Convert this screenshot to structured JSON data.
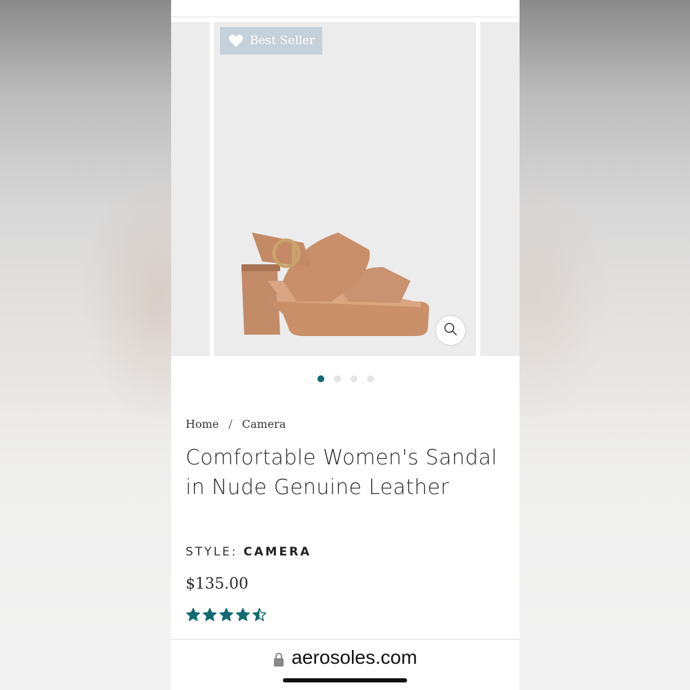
{
  "carousel": {
    "badge_label": "Best Seller",
    "slide_count": 4,
    "active_slide": 1
  },
  "breadcrumb": {
    "items": [
      "Home",
      "Camera"
    ],
    "separator": "/"
  },
  "product": {
    "title": "Comfortable Women's Sandal in Nude Genuine Leather",
    "style_label": "STYLE:",
    "style_value": "CAMERA",
    "price": "$135.00",
    "rating": 4.5,
    "rating_max": 5
  },
  "browser": {
    "url": "aerosoles.com"
  },
  "colors": {
    "accent": "#146a72",
    "badge_bg": "#c4d0da",
    "image_bg": "#ececec"
  },
  "icons": {
    "badge": "heart-icon",
    "zoom": "magnifier-icon",
    "url_lock": "lock-icon",
    "rating": "star-icon"
  }
}
